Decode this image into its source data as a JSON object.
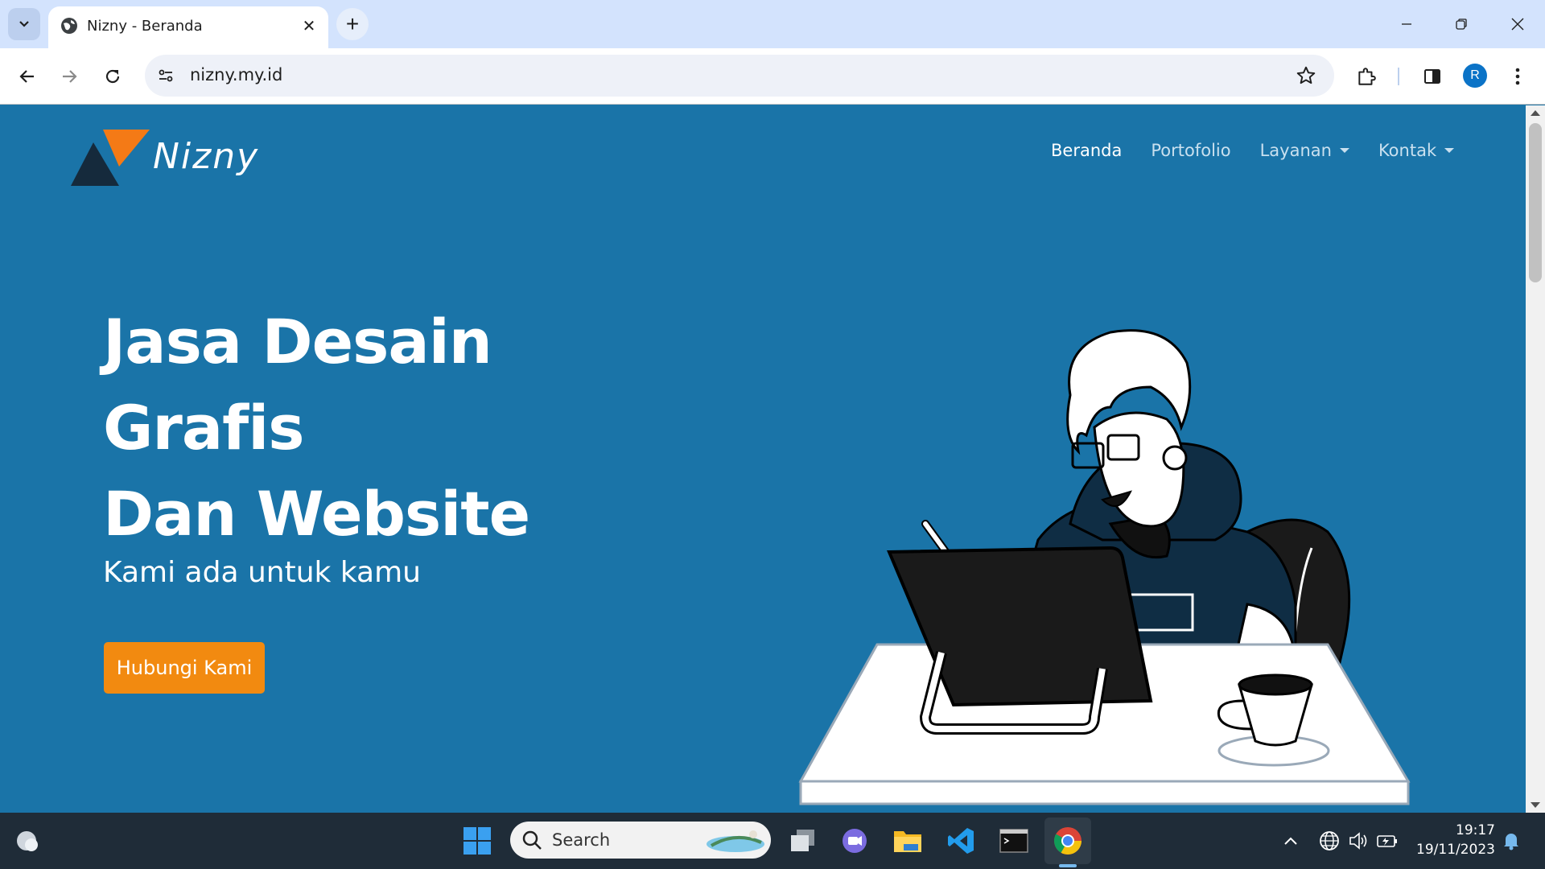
{
  "browser": {
    "tab_title": "Nizny - Beranda",
    "url": "nizny.my.id",
    "profile_initial": "R"
  },
  "site": {
    "brand": "Nizny",
    "nav": [
      {
        "label": "Beranda",
        "active": true
      },
      {
        "label": "Portofolio"
      },
      {
        "label": "Layanan",
        "dropdown": true
      },
      {
        "label": "Kontak",
        "dropdown": true
      }
    ],
    "hero": {
      "title_line1": "Jasa Desain Grafis",
      "title_line2": "Dan Website",
      "subtitle": "Kami ada untuk kamu",
      "cta": "Hubungi Kami"
    },
    "colors": {
      "background": "#1a74a8",
      "cta": "#f28a10",
      "logo_orange": "#f47a16",
      "logo_dark": "#152a3c"
    }
  },
  "taskbar": {
    "search_placeholder": "Search",
    "time": "19:17",
    "date": "19/11/2023"
  }
}
